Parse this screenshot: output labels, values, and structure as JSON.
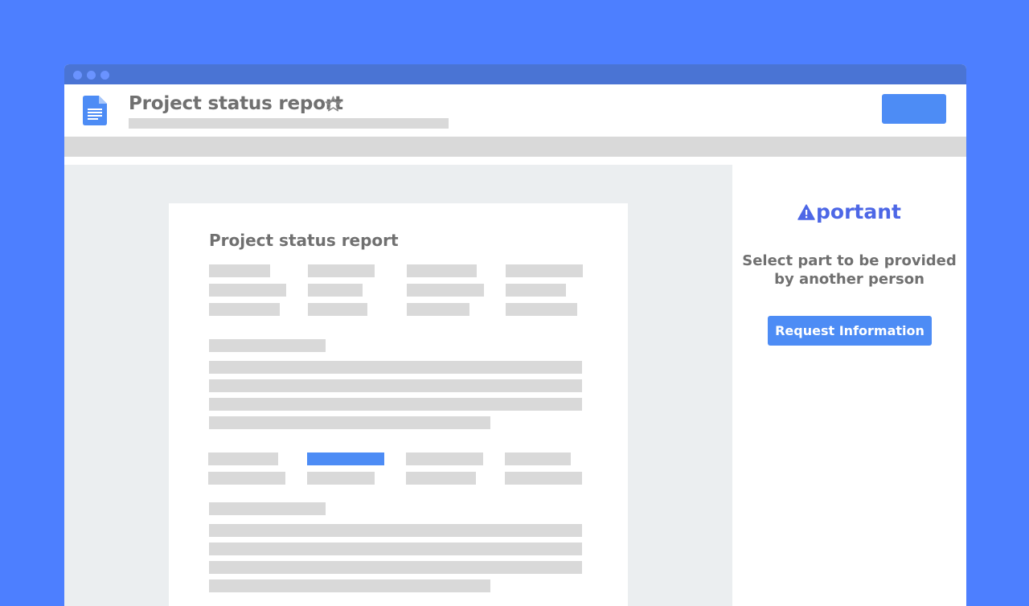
{
  "document": {
    "title": "Project status report",
    "star_icon": "star-outline-icon",
    "doc_icon": "google-docs-icon"
  },
  "page": {
    "heading": "Project status report"
  },
  "sidebar": {
    "brand_name": "portant",
    "brand_icon": "warning-triangle-icon",
    "instruction_line1": "Select part to be provided",
    "instruction_line2": "by another person",
    "request_button_label": "Request Information"
  },
  "colors": {
    "background": "#4d7fff",
    "titlebar": "#4a74d4",
    "accent": "#4d8cf5",
    "brand": "#4d67e6",
    "placeholder": "#d9d9d9",
    "text": "#707070"
  }
}
